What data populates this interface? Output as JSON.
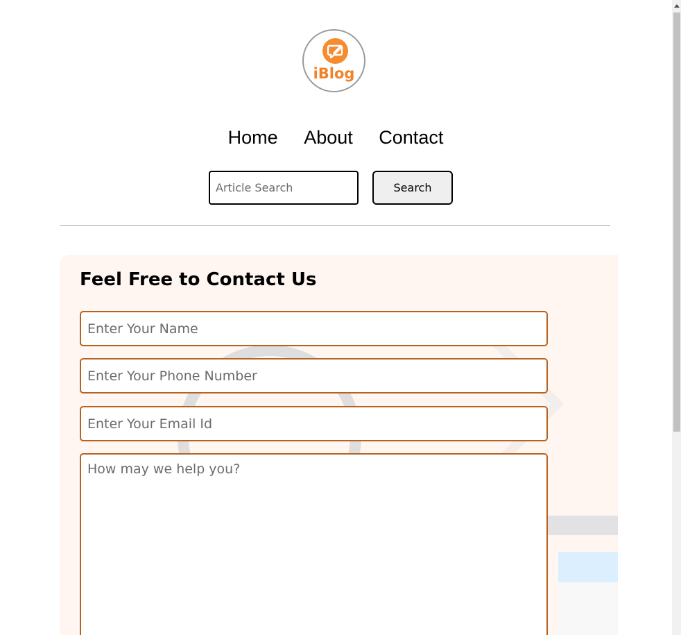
{
  "logo": {
    "text": "iBlog",
    "icon": "chat-pencil-icon",
    "color": "#f68b2f"
  },
  "nav": {
    "items": [
      "Home",
      "About",
      "Contact"
    ]
  },
  "search": {
    "placeholder": "Article Search",
    "button_label": "Search"
  },
  "contact": {
    "heading": "Feel Free to Contact Us",
    "name_placeholder": "Enter Your Name",
    "phone_placeholder": "Enter Your Phone Number",
    "email_placeholder": "Enter Your Email Id",
    "message_placeholder": "How may we help you?",
    "accent_color": "#b8621f",
    "background_color": "#fff6f2"
  }
}
